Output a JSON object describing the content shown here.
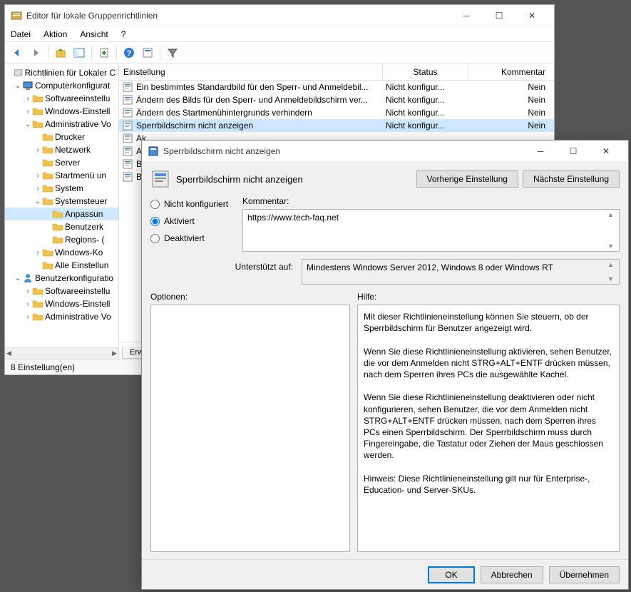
{
  "main": {
    "title": "Editor für lokale Gruppenrichtlinien",
    "menu": {
      "file": "Datei",
      "action": "Aktion",
      "view": "Ansicht",
      "help": "?"
    },
    "tree": {
      "root": "Richtlinien für Lokaler C",
      "computer": "Computerkonfigurat",
      "software1": "Softwareeinstellu",
      "windows1": "Windows-Einstell",
      "admin1": "Administrative Vo",
      "printers": "Drucker",
      "network": "Netzwerk",
      "server": "Server",
      "startmenu": "Startmenü un",
      "system": "System",
      "controlpanel": "Systemsteuer",
      "personalization": "Anpassun",
      "useraccounts": "Benutzerk",
      "regions": "Regions- (",
      "wincomponents": "Windows-Ko",
      "allsettings": "Alle Einstellun",
      "user": "Benutzerkonfiguratio",
      "software2": "Softwareeinstellu",
      "windows2": "Windows-Einstell",
      "admin2": "Administrative Vo"
    },
    "columns": {
      "setting": "Einstellung",
      "status": "Status",
      "comment": "Kommentar"
    },
    "settings": [
      {
        "name": "Ein bestimmtes Standardbild für den Sperr- und Anmeldebil...",
        "status": "Nicht konfigur...",
        "comment": "Nein"
      },
      {
        "name": "Ändern des Bilds für den Sperr- und Anmeldebildschirm ver...",
        "status": "Nicht konfigur...",
        "comment": "Nein"
      },
      {
        "name": "Ändern des Startmenühintergrunds verhindern",
        "status": "Nicht konfigur...",
        "comment": "Nein"
      },
      {
        "name": "Sperrbildschirm nicht anzeigen",
        "status": "Nicht konfigur...",
        "comment": "Nein",
        "selected": true
      },
      {
        "name": "Ak",
        "status": "",
        "comment": ""
      },
      {
        "name": "Ak",
        "status": "",
        "comment": ""
      },
      {
        "name": "Be",
        "status": "",
        "comment": ""
      },
      {
        "name": "Be",
        "status": "",
        "comment": ""
      }
    ],
    "tab": "Erwe",
    "status": "8 Einstellung(en)"
  },
  "dialog": {
    "title": "Sperrbildschirm nicht anzeigen",
    "heading": "Sperrbildschirm nicht anzeigen",
    "prev": "Vorherige Einstellung",
    "next": "Nächste Einstellung",
    "radios": {
      "notconf": "Nicht konfiguriert",
      "enabled": "Aktiviert",
      "disabled": "Deaktiviert"
    },
    "commentLabel": "Kommentar:",
    "commentValue": "https://www.tech-faq.net",
    "supportedLabel": "Unterstützt auf:",
    "supportedValue": "Mindestens Windows Server 2012, Windows 8 oder Windows RT",
    "optionsLabel": "Optionen:",
    "helpLabel": "Hilfe:",
    "help1": "Mit dieser Richtlinieneinstellung können Sie steuern, ob der Sperrbildschirm für Benutzer angezeigt wird.",
    "help2": "Wenn Sie diese Richtlinieneinstellung aktivieren, sehen Benutzer, die vor dem Anmelden nicht STRG+ALT+ENTF drücken müssen, nach dem Sperren ihres PCs die ausgewählte Kachel.",
    "help3": "Wenn Sie diese Richtlinieneinstellung deaktivieren oder nicht konfigurieren, sehen Benutzer, die vor dem Anmelden nicht STRG+ALT+ENTF drücken müssen, nach dem Sperren ihres PCs einen Sperrbildschirm. Der Sperrbildschirm muss durch Fingereingabe, die Tastatur oder Ziehen der Maus geschlossen werden.",
    "help4": "Hinweis: Diese Richtlinieneinstellung gilt nur für Enterprise-, Education- und Server-SKUs.",
    "ok": "OK",
    "cancel": "Abbrechen",
    "apply": "Übernehmen"
  }
}
